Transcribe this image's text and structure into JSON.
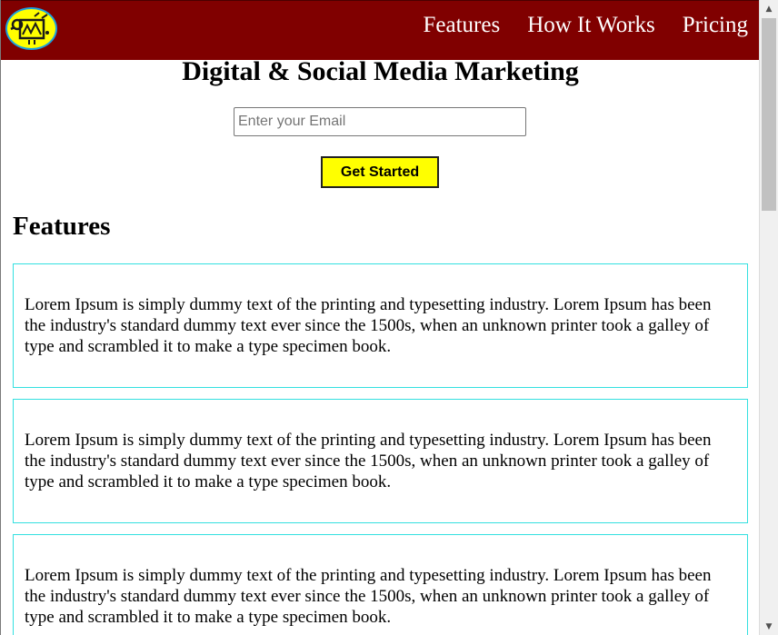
{
  "navbar": {
    "logo_icon": "logo-icon",
    "links": [
      {
        "label": "Features"
      },
      {
        "label": "How It Works"
      },
      {
        "label": "Pricing"
      }
    ],
    "background": "#800000"
  },
  "hero": {
    "title": "Digital & Social Media Marketing",
    "email_placeholder": "Enter your Email",
    "email_value": "",
    "cta_label": "Get Started",
    "cta_color": "#ffff00"
  },
  "features": {
    "title": "Features",
    "cards": [
      {
        "text": "Lorem Ipsum is simply dummy text of the printing and typesetting industry. Lorem Ipsum has been the industry's standard dummy text ever since the 1500s, when an unknown printer took a galley of type and scrambled it to make a type specimen book."
      },
      {
        "text": "Lorem Ipsum is simply dummy text of the printing and typesetting industry. Lorem Ipsum has been the industry's standard dummy text ever since the 1500s, when an unknown printer took a galley of type and scrambled it to make a type specimen book."
      },
      {
        "text": "Lorem Ipsum is simply dummy text of the printing and typesetting industry. Lorem Ipsum has been the industry's standard dummy text ever since the 1500s, when an unknown printer took a galley of type and scrambled it to make a type specimen book."
      }
    ],
    "card_border_color": "#33e0e0"
  },
  "scrollbar": {
    "up_icon": "scroll-up-arrow-icon",
    "down_icon": "scroll-down-arrow-icon"
  }
}
